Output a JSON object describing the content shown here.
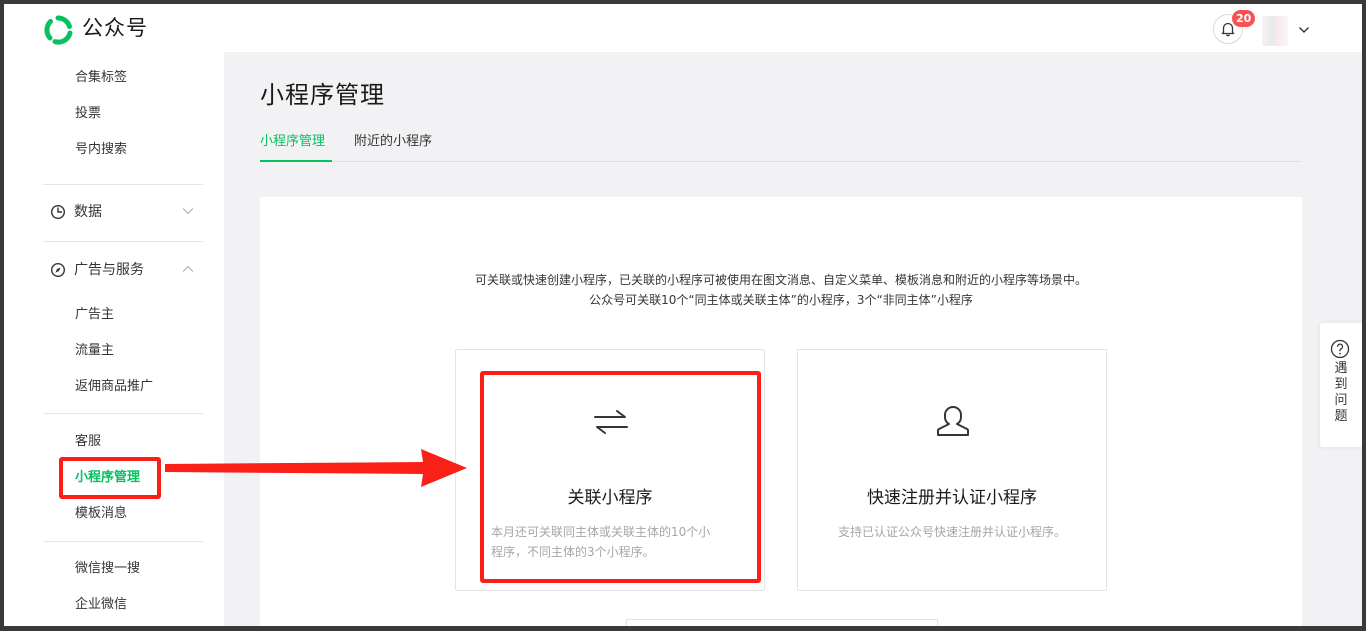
{
  "header": {
    "brand": "公众号",
    "notification_count": "20"
  },
  "sidebar": {
    "items_top": [
      "合集标签",
      "投票",
      "号内搜索"
    ],
    "group_data": "数据",
    "group_ads": "广告与服务",
    "ads_items": [
      "广告主",
      "流量主",
      "返佣商品推广"
    ],
    "service_items": [
      "客服",
      "小程序管理",
      "模板消息"
    ],
    "bottom_items": [
      "微信搜一搜",
      "企业微信"
    ]
  },
  "main": {
    "title": "小程序管理",
    "tabs": [
      {
        "label": "小程序管理",
        "active": true
      },
      {
        "label": "附近的小程序",
        "active": false
      }
    ],
    "desc_line1": "可关联或快速创建小程序，已关联的小程序可被使用在图文消息、自定义菜单、模板消息和附近的小程序等场景中。",
    "desc_line2": "公众号可关联10个“同主体或关联主体”的小程序，3个“非同主体”小程序",
    "options": [
      {
        "title": "关联小程序",
        "desc_line1": "本月还可关联同主体或关联主体的10个小",
        "desc_line2": "程序，不同主体的3个小程序。",
        "icon": "swap-arrows-icon"
      },
      {
        "title": "快速注册并认证小程序",
        "desc_line1": "支持已认证公众号快速注册并认证小程序。",
        "icon": "user-icon"
      }
    ]
  },
  "help": {
    "chars": [
      "遇",
      "到",
      "问",
      "题"
    ]
  },
  "colors": {
    "accent": "#07c160",
    "annotation": "#fa2018",
    "badge": "#fa5151"
  }
}
